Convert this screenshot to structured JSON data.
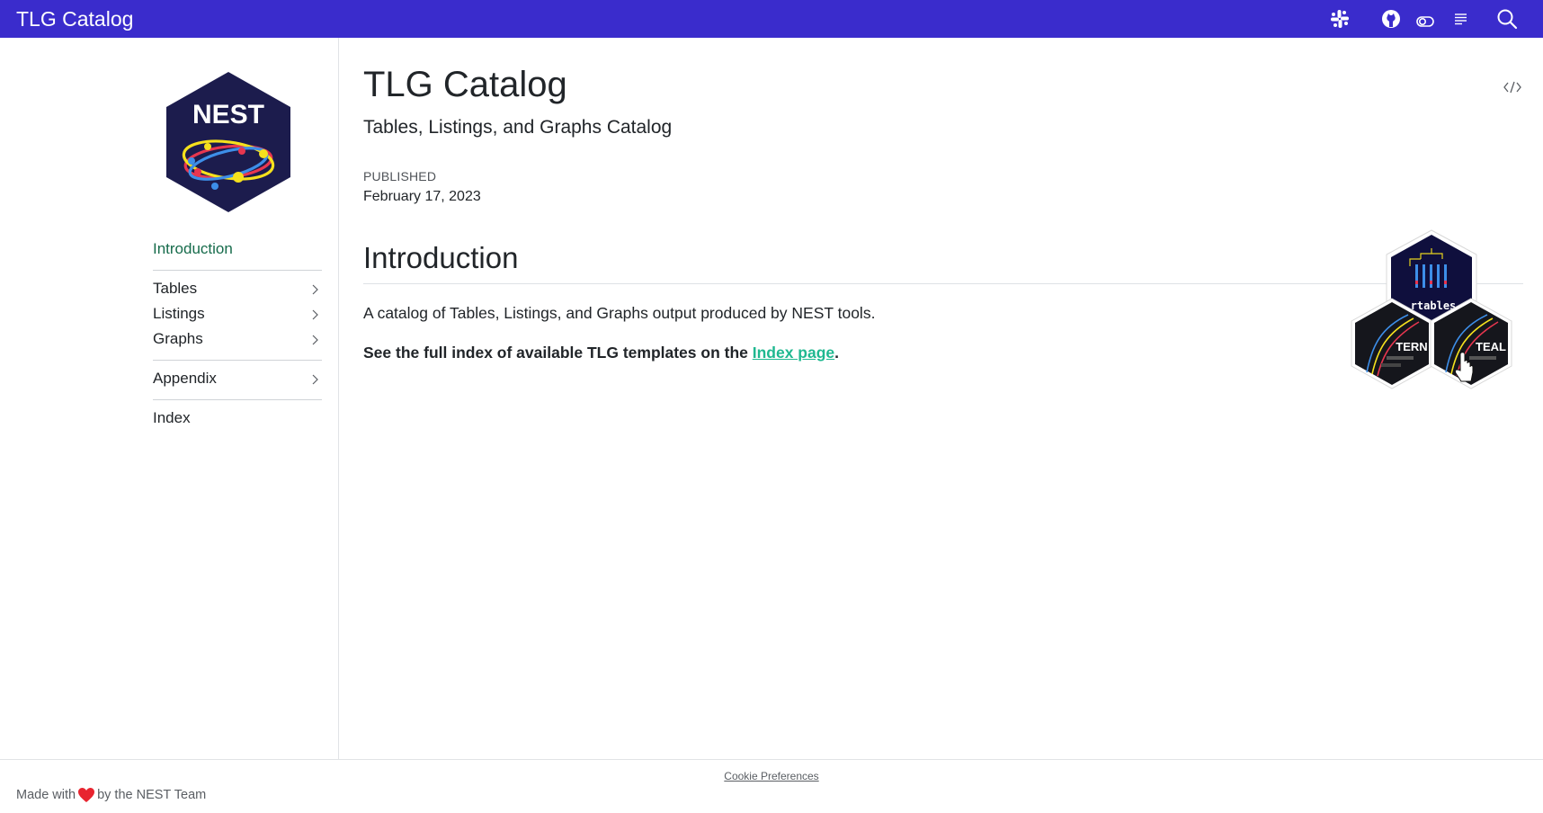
{
  "navbar": {
    "brand": "TLG Catalog",
    "bg_color": "#3a2ccc",
    "icons": [
      "slack-icon",
      "github-icon",
      "toggle-icon",
      "reader-mode-icon",
      "search-icon"
    ]
  },
  "sidebar": {
    "logo_text": "NEST",
    "items": [
      {
        "label": "Introduction",
        "active": true
      },
      {
        "label": "Tables"
      },
      {
        "label": "Listings"
      },
      {
        "label": "Graphs"
      },
      {
        "label": "Appendix"
      },
      {
        "label": "Index"
      }
    ]
  },
  "main": {
    "title": "TLG Catalog",
    "subtitle": "Tables, Listings, and Graphs Catalog",
    "published_label": "Published",
    "published_date": "February 17, 2023",
    "section_heading": "Introduction",
    "paragraph": "A catalog of Tables, Listings, and Graphs output produced by NEST tools.",
    "bold_prefix": "See the full index of available TLG templates on the ",
    "link_text": "Index page",
    "bold_suffix": ".",
    "hex_labels": [
      "rtables",
      "TERN",
      "TEAL"
    ]
  },
  "footer": {
    "made_with": "Made with",
    "by_team": "by the NEST Team",
    "cookie": "Cookie Preferences"
  }
}
